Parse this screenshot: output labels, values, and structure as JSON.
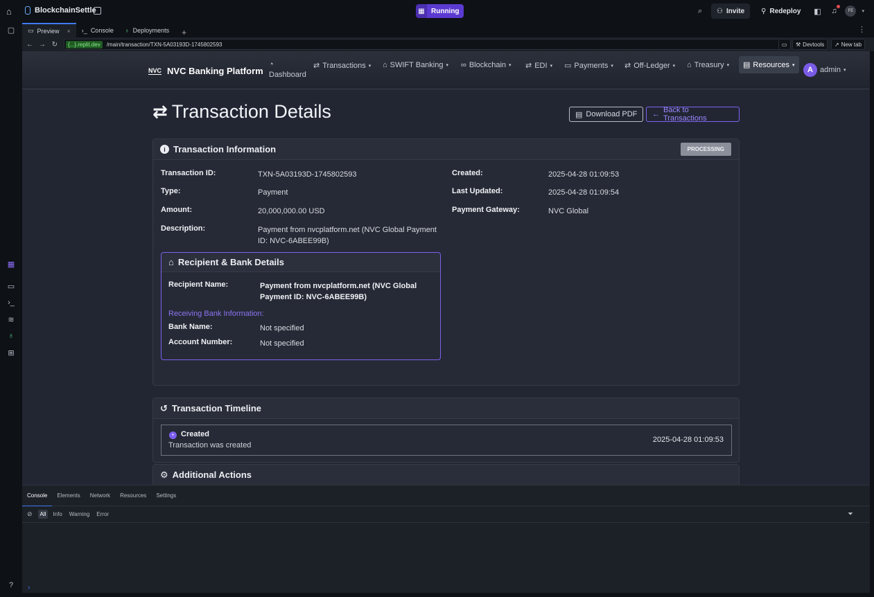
{
  "topbar": {
    "project_name": "BlockchainSettle",
    "run_status": "Running",
    "invite_label": "Invite",
    "redeploy_label": "Redeploy",
    "avatar_initials": "FE"
  },
  "tabs": [
    {
      "label": "Preview"
    },
    {
      "label": "Console"
    },
    {
      "label": "Deployments"
    }
  ],
  "urlbar": {
    "domain": "{...}.replit.dev",
    "path": "/main/transaction/TXN-5A03193D-1745802593",
    "devtools_label": "Devtools",
    "newtab_label": "New tab"
  },
  "app": {
    "brand": "NVC Banking Platform",
    "brand_logo": "NVC",
    "nav": {
      "dashboard": "Dashboard",
      "transactions": "Transactions",
      "swift": "SWIFT Banking",
      "blockchain": "Blockchain",
      "edi": "EDI",
      "payments": "Payments",
      "offledger": "Off-Ledger",
      "treasury": "Treasury",
      "resources": "Resources",
      "user": "admin",
      "user_initial": "A"
    },
    "page_title": "Transaction Details",
    "download_pdf": "Download PDF",
    "back_label": "Back to Transactions",
    "info": {
      "header": "Transaction Information",
      "status": "PROCESSING",
      "transaction_id_label": "Transaction ID:",
      "transaction_id": "TXN-5A03193D-1745802593",
      "type_label": "Type:",
      "type": "Payment",
      "amount_label": "Amount:",
      "amount": "20,000,000.00 USD",
      "description_label": "Description:",
      "description_line1": "Payment from nvcplatform.net (NVC Global Payment",
      "description_line2": "ID: NVC-6ABEE99B)",
      "created_label": "Created:",
      "created": "2025-04-28 01:09:53",
      "updated_label": "Last Updated:",
      "updated": "2025-04-28 01:09:54",
      "gateway_label": "Payment Gateway:",
      "gateway": "NVC Global"
    },
    "recipient": {
      "header": "Recipient & Bank Details",
      "name_label": "Recipient Name:",
      "name_line1": "Payment from nvcplatform.net (NVC Global",
      "name_line2": "Payment ID: NVC-6ABEE99B)",
      "bank_info_label": "Receiving Bank Information:",
      "bank_name_label": "Bank Name:",
      "bank_name": "Not specified",
      "account_label": "Account Number:",
      "account": "Not specified"
    },
    "timeline": {
      "header": "Transaction Timeline",
      "item_title": "Created",
      "item_desc": "Transaction was created",
      "item_time": "2025-04-28 01:09:53"
    },
    "actions_header": "Additional Actions"
  },
  "devtools": {
    "tabs": [
      "Console",
      "Elements",
      "Network",
      "Resources",
      "Settings"
    ],
    "levels": [
      "All",
      "Info",
      "Warning",
      "Error"
    ]
  }
}
